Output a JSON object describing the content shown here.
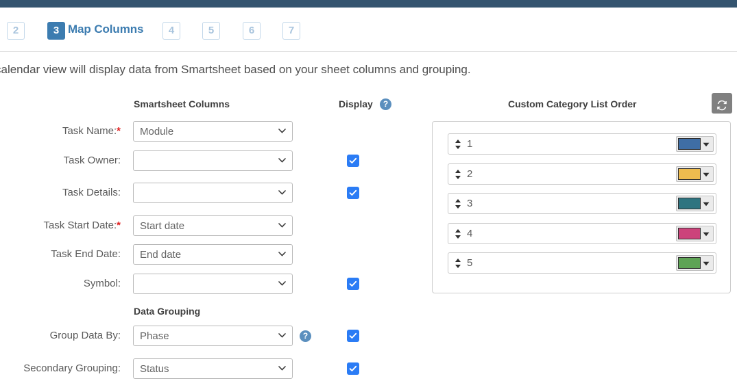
{
  "theme": {
    "top_bar_color": "#34546f",
    "accent_blue": "#3c7cb0",
    "checkbox_blue": "#2b7cf5",
    "required_star_color": "#e02020",
    "refresh_button_color": "#808080"
  },
  "wizard": {
    "steps": [
      {
        "number": "2",
        "active": false
      },
      {
        "number": "3",
        "active": true
      },
      {
        "number": "4",
        "active": false
      },
      {
        "number": "5",
        "active": false
      },
      {
        "number": "6",
        "active": false
      },
      {
        "number": "7",
        "active": false
      }
    ],
    "active_step_label": "Map Columns"
  },
  "intro_text": "calendar view will display data from Smartsheet based on your sheet columns and grouping.",
  "headings": {
    "smartsheet_columns": "Smartsheet Columns",
    "display": "Display",
    "custom_category_list_order": "Custom Category List Order",
    "data_grouping": "Data Grouping"
  },
  "icons": {
    "display_help": "?",
    "group_help": "?",
    "refresh": "refresh-icon"
  },
  "form_rows": [
    {
      "label": "Task Name:",
      "required": true,
      "value": "Module",
      "has_checkbox": false,
      "checked": false
    },
    {
      "label": "Task Owner:",
      "required": false,
      "value": "",
      "has_checkbox": true,
      "checked": true
    },
    {
      "label": "Task Details:",
      "required": false,
      "value": "",
      "has_checkbox": true,
      "checked": true
    },
    {
      "label": "Task Start Date:",
      "required": true,
      "value": "Start date",
      "has_checkbox": false,
      "checked": false
    },
    {
      "label": "Task End Date:",
      "required": false,
      "value": "End date",
      "has_checkbox": false,
      "checked": false
    },
    {
      "label": "Symbol:",
      "required": false,
      "value": "",
      "has_checkbox": true,
      "checked": true
    },
    {
      "label": "Group Data By:",
      "required": false,
      "value": "Phase",
      "has_checkbox": true,
      "checked": true
    },
    {
      "label": "Secondary Grouping:",
      "required": false,
      "value": "Status",
      "has_checkbox": true,
      "checked": true
    }
  ],
  "category_rows": [
    {
      "index": "1",
      "color": "#3f6ea5"
    },
    {
      "index": "2",
      "color": "#eebc4f"
    },
    {
      "index": "3",
      "color": "#2f7480"
    },
    {
      "index": "4",
      "color": "#cc437b"
    },
    {
      "index": "5",
      "color": "#5ea355"
    }
  ]
}
